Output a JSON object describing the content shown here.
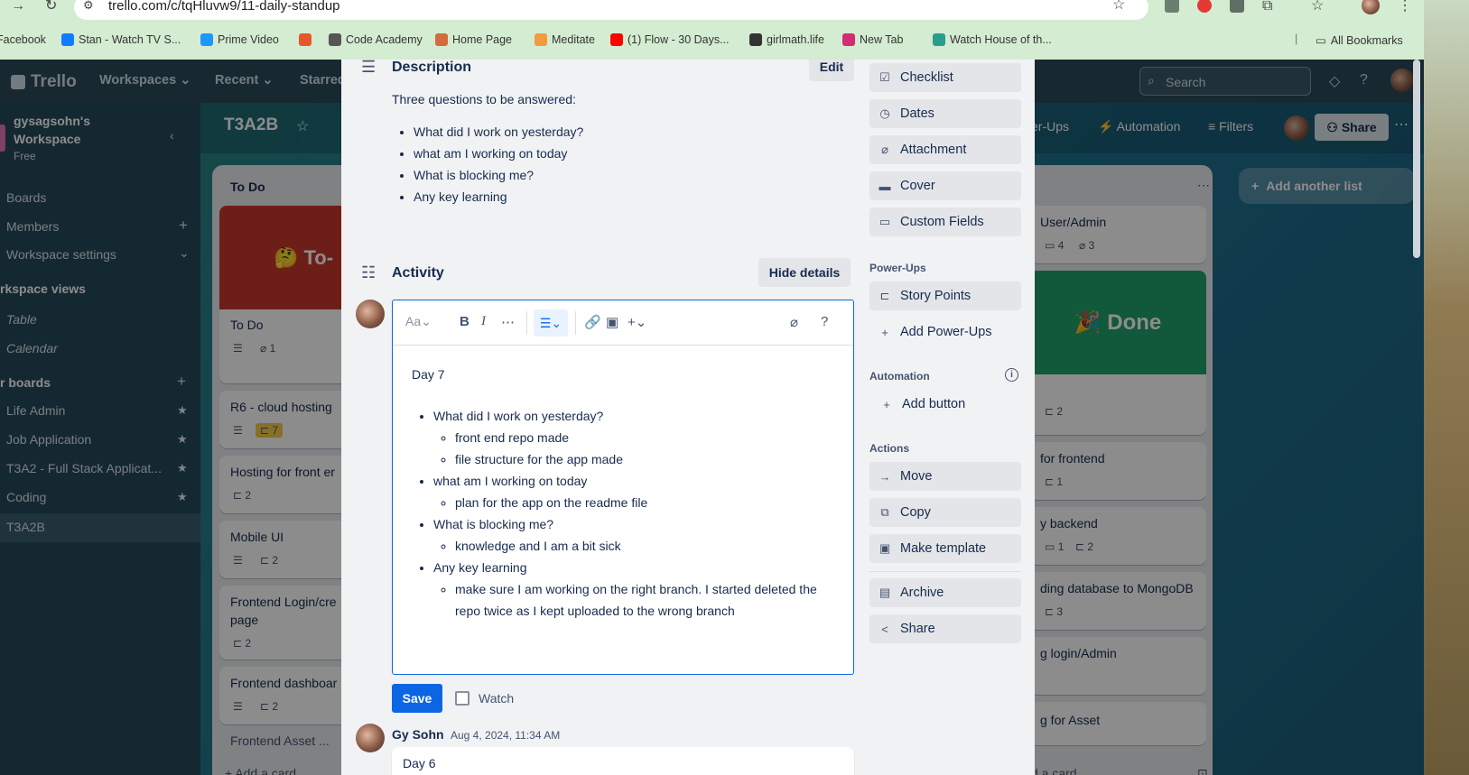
{
  "browser": {
    "url": "trello.com/c/tqHluvw9/11-daily-standup",
    "bookmarks": [
      {
        "label": "Facebook",
        "color": "#1877f2"
      },
      {
        "label": "Stan - Watch TV S...",
        "color": "#0f7cff"
      },
      {
        "label": "Prime Video",
        "color": "#1a98ff"
      },
      {
        "label": "",
        "color": "#e8572a"
      },
      {
        "label": "Code Academy",
        "color": "#555555"
      },
      {
        "label": "Home Page",
        "color": "#d46b3c"
      },
      {
        "label": "Meditate",
        "color": "#f19a3e"
      },
      {
        "label": "(1) Flow - 30 Days...",
        "color": "#ff0000"
      },
      {
        "label": "girlmath.life",
        "color": "#333333"
      },
      {
        "label": "New Tab",
        "color": "#d62976"
      },
      {
        "label": "Watch House of th...",
        "color": "#2a9d8f"
      }
    ],
    "all_bookmarks": "All Bookmarks"
  },
  "trello": {
    "logo": "Trello",
    "nav": {
      "workspaces": "Workspaces",
      "recent": "Recent",
      "starred": "Starred"
    },
    "search_placeholder": "Search",
    "sidebar": {
      "workspace_name": "gysagsohn's Workspace",
      "plan": "Free",
      "boards": "Boards",
      "members": "Members",
      "workspace_settings": "Workspace settings",
      "views_heading": "rkspace views",
      "table": "Table",
      "calendar": "Calendar",
      "your_boards": "r boards",
      "board_list": [
        "Life Admin",
        "Job Application",
        "T3A2 - Full Stack Applicat...",
        "Coding",
        "T3A2B"
      ]
    },
    "board": {
      "title": "T3A2B",
      "powerups": "er-Ups",
      "automation": "Automation",
      "filters": "Filters",
      "share": "Share",
      "add_list": "Add another list"
    },
    "list_todo": {
      "title": "To Do",
      "cover_text": "🤔 To-",
      "cards": [
        {
          "title": "To Do",
          "badge": "1"
        },
        {
          "title": "R6 - cloud hosting",
          "badge": "7"
        },
        {
          "title": "Hosting for front er",
          "badge": "2"
        },
        {
          "title": "Mobile UI",
          "badge": "2"
        },
        {
          "title": "Frontend Login/cre",
          "title2": "page",
          "badge": "2"
        },
        {
          "title": "Frontend dashboar",
          "badge": "2"
        }
      ],
      "add_card": "Add a card",
      "partial": "Frontend Asset ..."
    },
    "list_done": {
      "card1_title": "User/Admin",
      "card1_badges": [
        "4",
        "3"
      ],
      "cover_text": "🎉 Done",
      "badge_after_cover": "2",
      "cards": [
        {
          "title": "for frontend",
          "badge": "1"
        },
        {
          "title": "y backend",
          "badges": [
            "1",
            "2"
          ]
        },
        {
          "title": "ding database to MongoDB",
          "badge": "3"
        },
        {
          "title": "g login/Admin"
        },
        {
          "title": "g for Asset"
        }
      ],
      "add_card": "d a card"
    }
  },
  "modal": {
    "description": {
      "heading": "Description",
      "edit": "Edit",
      "intro": "Three questions to be answered:",
      "items": [
        "What did I work on yesterday?",
        "what am I working on today",
        "What is blocking me?",
        "Any key learning"
      ]
    },
    "activity": {
      "heading": "Activity",
      "hide_details": "Hide details"
    },
    "editor": {
      "text_style": "Aa",
      "day": "Day 7",
      "items": [
        {
          "text": "What did I work on yesterday?",
          "sub": [
            "front end repo made",
            "file structure for the app made"
          ]
        },
        {
          "text": "what am I working on today",
          "sub": [
            "plan for the app on the readme file"
          ]
        },
        {
          "text": "What is blocking me?",
          "sub": [
            "knowledge and I am a bit sick"
          ]
        },
        {
          "text": "Any key learning",
          "sub": [
            "make sure I am working on the right branch. I started deleted the repo twice as I kept uploaded to the wrong branch"
          ]
        }
      ]
    },
    "save": "Save",
    "watch": "Watch",
    "comment": {
      "author": "Gy Sohn",
      "time": "Aug 4, 2024, 11:34 AM",
      "text": "Day 6"
    },
    "side": {
      "checklist": "Checklist",
      "dates": "Dates",
      "attachment": "Attachment",
      "cover": "Cover",
      "custom_fields": "Custom Fields",
      "powerups_label": "Power-Ups",
      "story_points": "Story Points",
      "add_powerups": "Add Power-Ups",
      "automation_label": "Automation",
      "add_button": "Add button",
      "actions_label": "Actions",
      "move": "Move",
      "copy": "Copy",
      "make_template": "Make template",
      "archive": "Archive",
      "share": "Share"
    }
  }
}
